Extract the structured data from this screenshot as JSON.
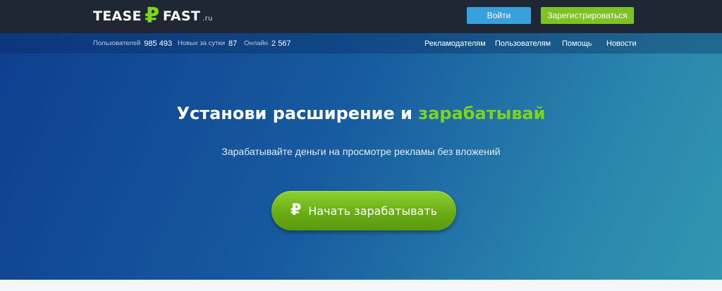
{
  "header": {
    "logo": {
      "part1": "TEASE",
      "symbol": "₽",
      "part2": "FAST",
      "tld": ".ru"
    },
    "login_label": "Войти",
    "register_label": "Зарегистрироваться"
  },
  "stats": [
    {
      "label": "Пользователей",
      "value": "985 493"
    },
    {
      "label": "Новых за сутки",
      "value": "87"
    },
    {
      "label": "Онлайн",
      "value": "2 567"
    }
  ],
  "nav": [
    {
      "label": "Рекламодателям"
    },
    {
      "label": "Пользователям"
    },
    {
      "label": "Помощь"
    },
    {
      "label": "Новости"
    }
  ],
  "hero": {
    "headline_main": "Установи расширение и ",
    "headline_accent": "зарабатывай",
    "subheadline": "Зарабатывайте деньги на просмотре рекламы без вложений",
    "cta_icon": "₽",
    "cta_label": "Начать зарабатывать"
  },
  "colors": {
    "topbar": "#1e2733",
    "accent_green": "#7ed321",
    "login_blue": "#3aa0dc",
    "register_green": "#7ec326"
  },
  "icons": {
    "logo_symbol": "ruble-icon",
    "cta_icon": "ruble-icon"
  }
}
